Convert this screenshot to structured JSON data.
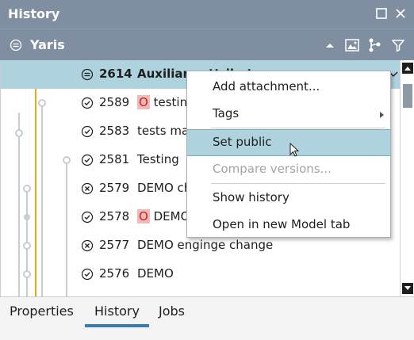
{
  "window": {
    "title": "History"
  },
  "header": {
    "model_name": "Yaris"
  },
  "rows": [
    {
      "number": "2614",
      "desc": "Auxiliary attributes",
      "badge": "",
      "status": "in-work-icon",
      "selected": true
    },
    {
      "number": "2589",
      "desc": "testing",
      "badge": "O",
      "status": "check-circle-icon",
      "selected": false
    },
    {
      "number": "2583",
      "desc": "tests ma",
      "badge": "",
      "status": "check-circle-icon",
      "selected": false
    },
    {
      "number": "2581",
      "desc": "Testing",
      "badge": "",
      "status": "check-circle-icon",
      "selected": false
    },
    {
      "number": "2579",
      "desc": "DEMO ch",
      "badge": "",
      "status": "x-circle-icon",
      "selected": false
    },
    {
      "number": "2578",
      "desc": "DEMO",
      "badge": "O",
      "status": "check-circle-icon",
      "selected": false
    },
    {
      "number": "2577",
      "desc": "DEMO enginge change",
      "badge": "",
      "status": "x-circle-icon",
      "selected": false
    },
    {
      "number": "2576",
      "desc": "DEMO",
      "badge": "",
      "status": "check-circle-icon",
      "selected": false
    }
  ],
  "context_menu": {
    "add_attachment": "Add attachment...",
    "tags": "Tags",
    "set_public": "Set public",
    "compare_versions": "Compare versions...",
    "show_history": "Show history",
    "open_model_tab": "Open in new Model tab"
  },
  "tabs": {
    "properties": "Properties",
    "history": "History",
    "jobs": "Jobs",
    "active": "History"
  },
  "colors": {
    "header": "#7f8fa1",
    "selection": "#aed2de",
    "accent": "#3a7bb0",
    "graph_main": "#e6a817",
    "graph_other": "#c8cdd3",
    "badge_bg": "#f4b8b8",
    "badge_fg": "#c62020"
  }
}
